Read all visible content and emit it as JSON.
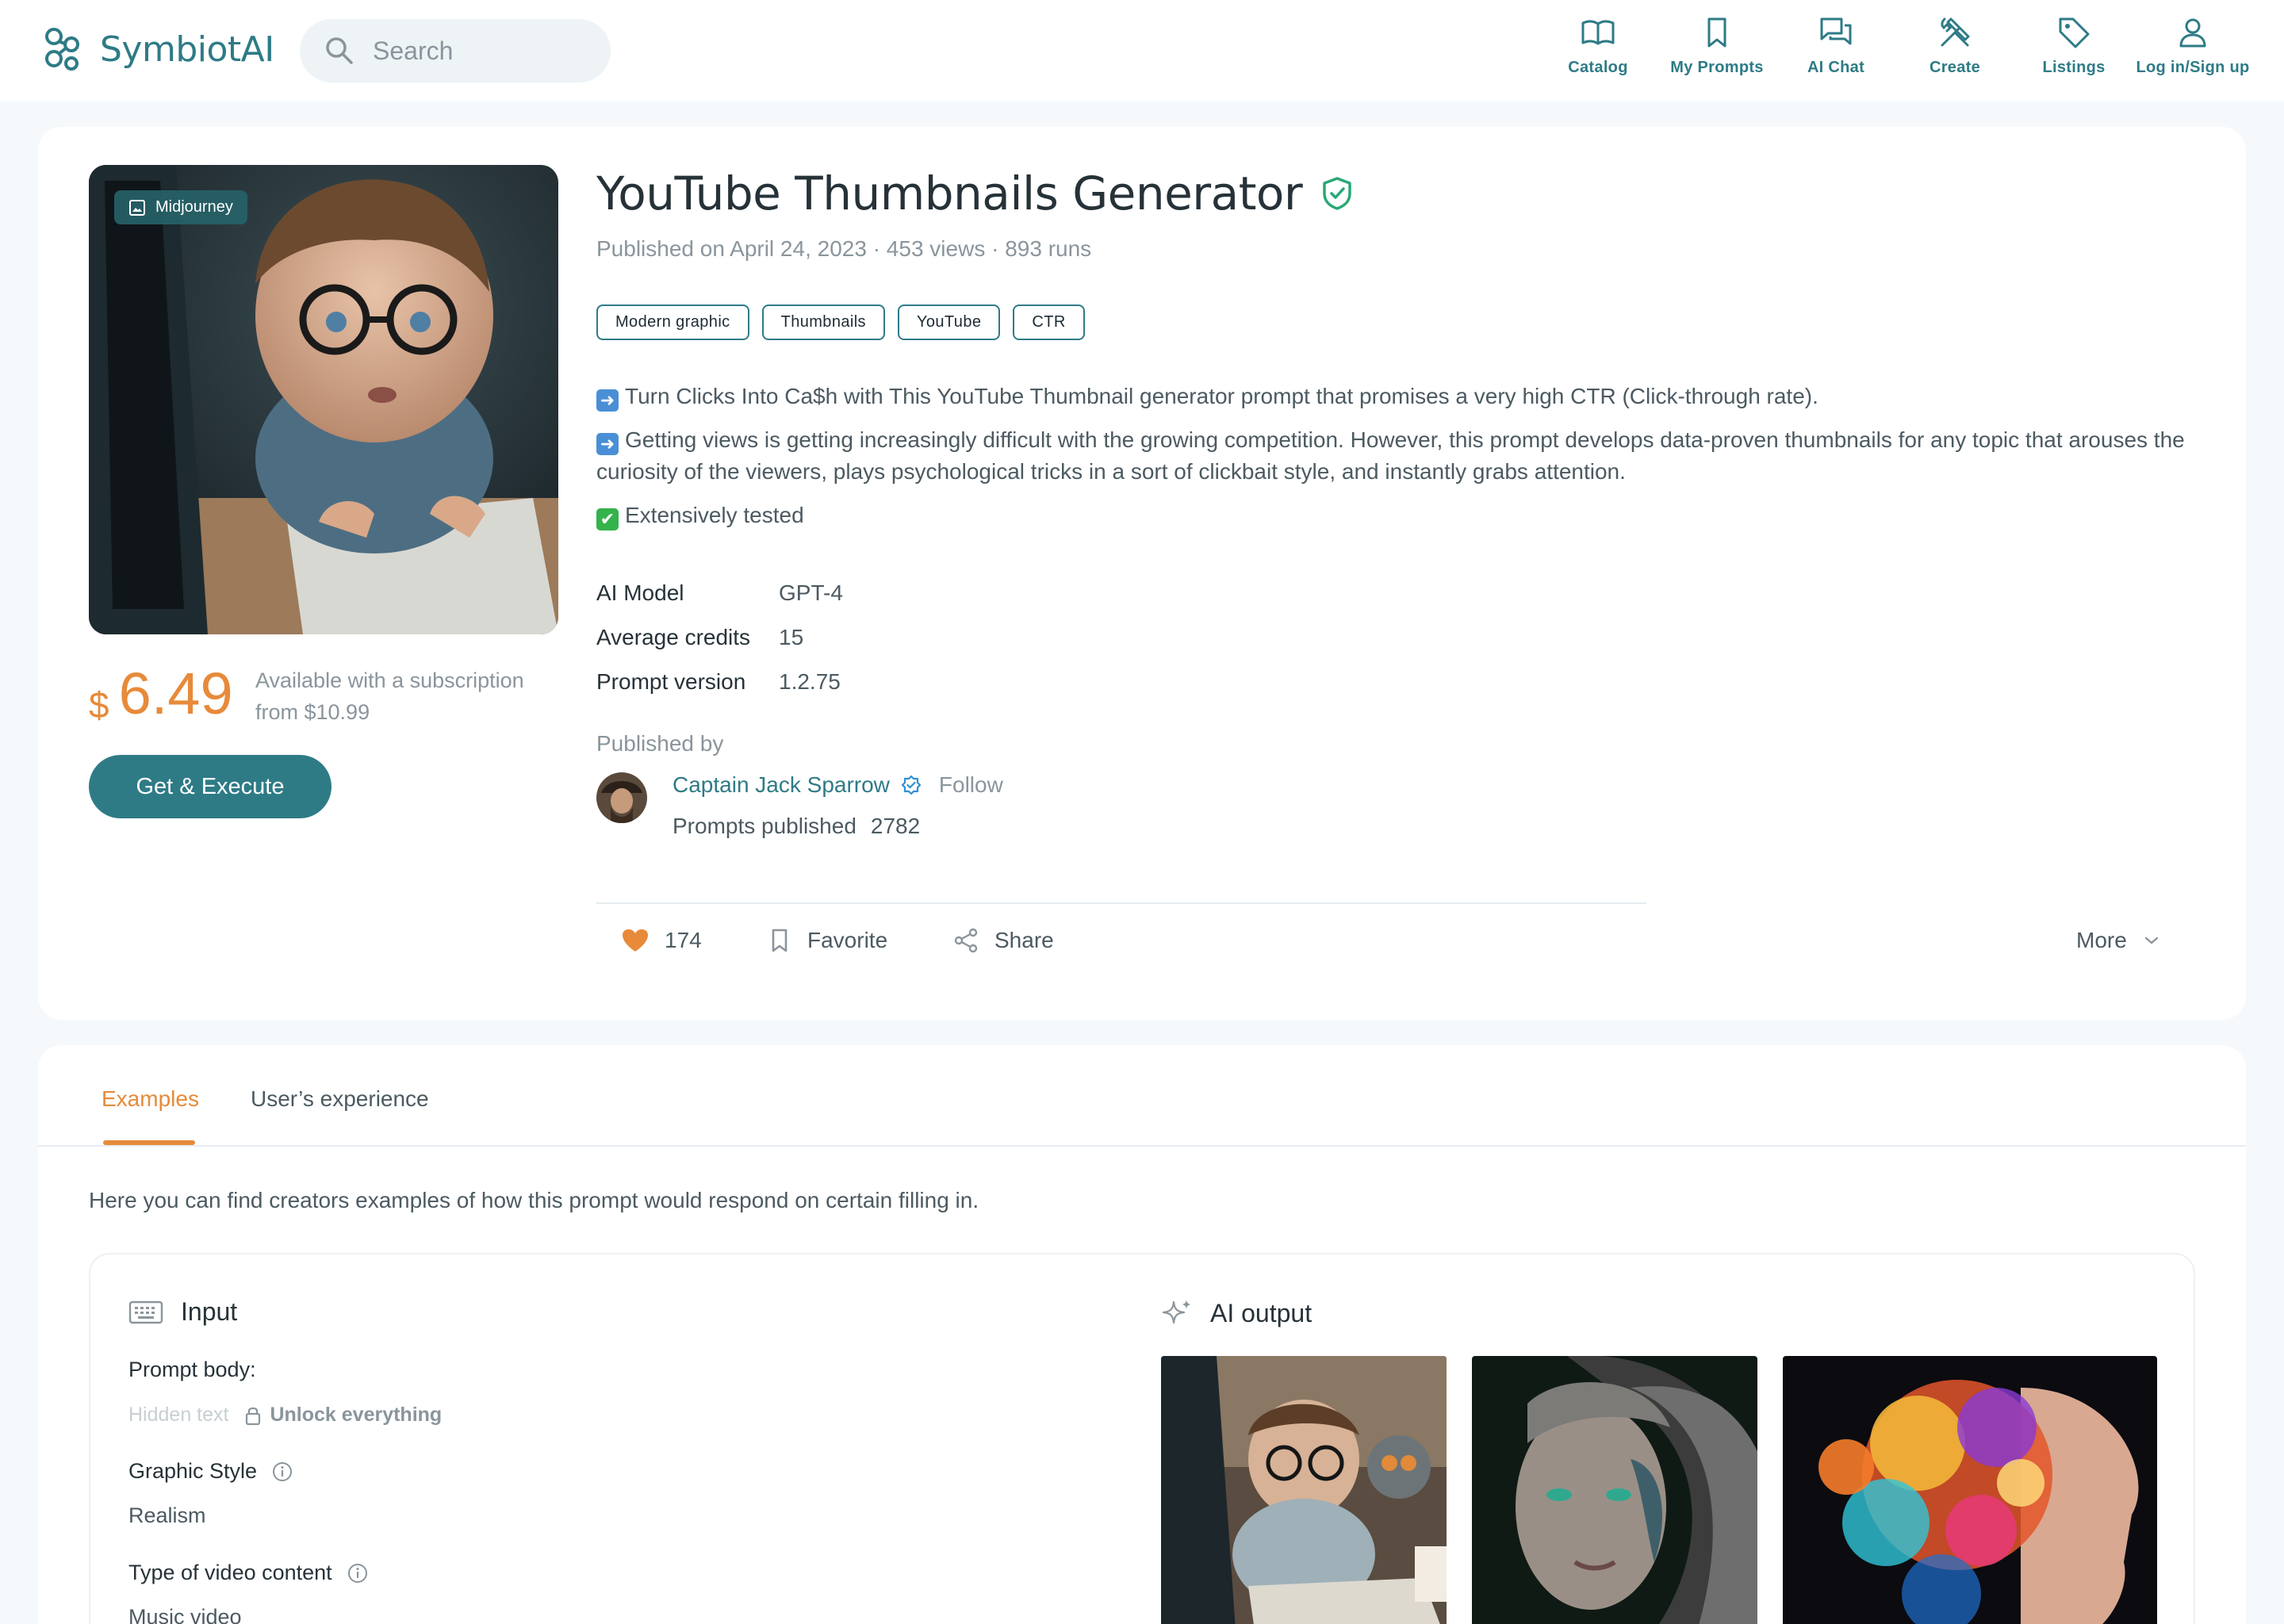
{
  "app": {
    "name": "SymbiotAI",
    "search_placeholder": "Search",
    "brand_color": "#2e7b86",
    "accent_color": "#e78a3a"
  },
  "nav": {
    "catalog": "Catalog",
    "my_prompts": "My Prompts",
    "ai_chat": "AI Chat",
    "create": "Create",
    "listings": "Listings",
    "login": "Log in/Sign up"
  },
  "prompt": {
    "engine_badge": "Midjourney",
    "title": "YouTube Thumbnails Generator",
    "meta": "Published on April 24, 2023 · 453 views · 893 runs",
    "tags": [
      "Modern graphic",
      "Thumbnails",
      "YouTube",
      "CTR"
    ],
    "description": [
      "Turn Clicks Into Ca$h with This YouTube Thumbnail generator prompt that promises a very high CTR (Click-through rate).",
      "Getting views is getting increasingly difficult with the growing competition. However, this prompt develops data-proven thumbnails for any topic that arouses the curiosity of the viewers, plays psychological tricks in a sort of clickbait style, and instantly grabs attention.",
      "Extensively tested"
    ],
    "specs": [
      {
        "key": "AI Model",
        "value": "GPT-4"
      },
      {
        "key": "Average credits",
        "value": "15"
      },
      {
        "key": "Prompt version",
        "value": "1.2.75"
      }
    ],
    "price_currency": "$",
    "price": "6.49",
    "subscription_note": "Available with a subscription from $10.99",
    "cta": "Get & Execute",
    "published_by_label": "Published by",
    "author": "Captain Jack Sparrow",
    "follow": "Follow",
    "prompts_published_label": "Prompts published",
    "prompts_published": "2782",
    "likes": "174",
    "favorite": "Favorite",
    "share": "Share",
    "more": "More"
  },
  "tabs": {
    "examples": "Examples",
    "experience": "User’s experience"
  },
  "examples": {
    "intro": "Here you can find creators examples of how this prompt would respond on certain filling in.",
    "input_title": "Input",
    "output_title": "AI output",
    "prompt_body_label": "Prompt body:",
    "hidden_text": "Hidden text",
    "unlock": "Unlock everything",
    "fields": [
      {
        "label": "Graphic Style",
        "value": "Realism"
      },
      {
        "label": "Type of video content",
        "value": "Music video"
      }
    ]
  }
}
